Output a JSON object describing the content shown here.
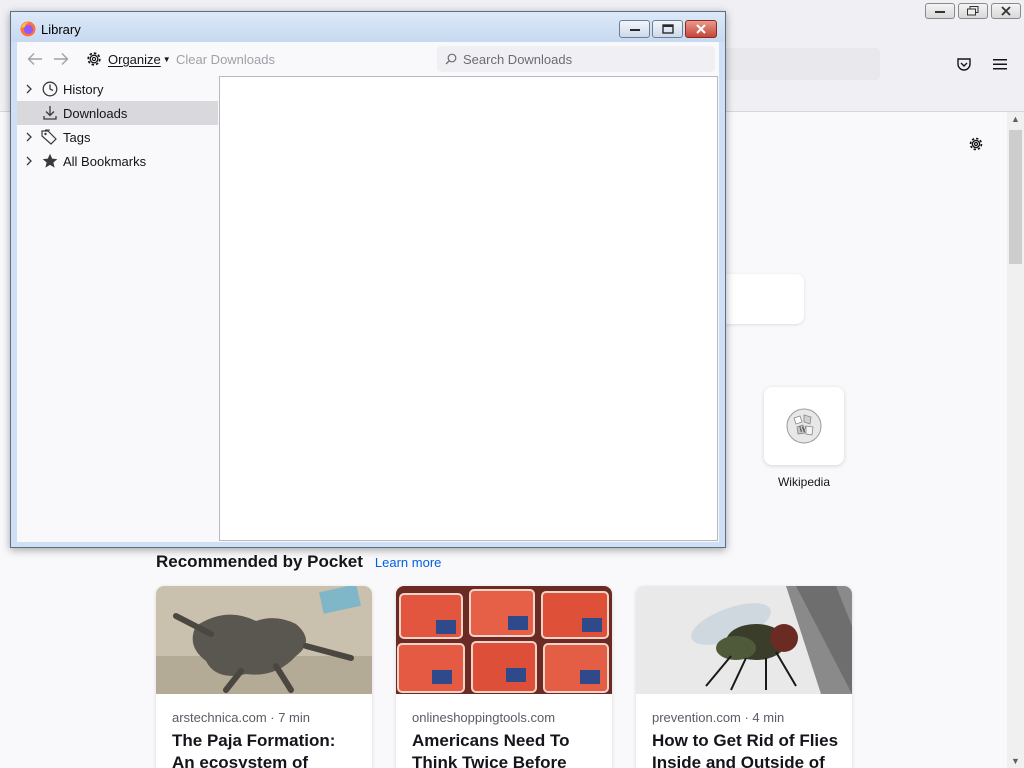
{
  "browser": {
    "shortcut": {
      "label": "Wikipedia",
      "icon": "wikipedia-globe-icon"
    },
    "pocket": {
      "title": "Recommended by Pocket",
      "learn_more": "Learn more",
      "stories": [
        {
          "meta": "arstechnica.com · 7 min",
          "title": "The Paja Formation: An ecosystem of monsters",
          "image": "fossil-skeleton-image"
        },
        {
          "meta": "onlineshoppingtools.com",
          "title": "Americans Need To Think Twice Before",
          "image": "ground-meat-packages-image"
        },
        {
          "meta": "prevention.com · 4 min",
          "title": "How to Get Rid of Flies Inside and Outside of",
          "image": "house-fly-image"
        }
      ]
    }
  },
  "library": {
    "title": "Library",
    "toolbar": {
      "organize_label": "Organize",
      "clear_downloads": "Clear Downloads",
      "search_placeholder": "Search Downloads"
    },
    "sidebar": [
      {
        "label": "History",
        "icon": "clock-icon",
        "expandable": true,
        "selected": false
      },
      {
        "label": "Downloads",
        "icon": "download-icon",
        "expandable": false,
        "selected": true
      },
      {
        "label": "Tags",
        "icon": "tag-icon",
        "expandable": true,
        "selected": false
      },
      {
        "label": "All Bookmarks",
        "icon": "star-icon",
        "expandable": true,
        "selected": false
      }
    ]
  },
  "colors": {
    "accent_link": "#0060df",
    "selected_row": "#d8d8dd",
    "close_button": "#c6453a"
  }
}
